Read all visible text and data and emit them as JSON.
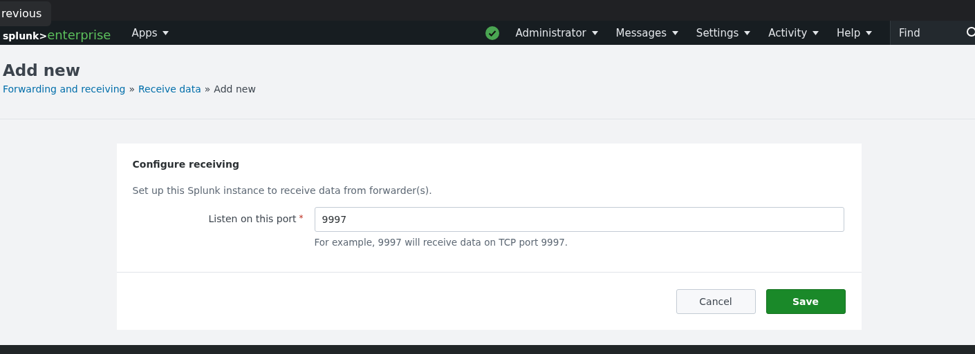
{
  "tooltip": {
    "text": "revious"
  },
  "logo": {
    "brand": "splunk>",
    "product": "enterprise"
  },
  "nav": {
    "apps": "Apps",
    "status_ok": true,
    "menus": [
      {
        "label": "Administrator"
      },
      {
        "label": "Messages"
      },
      {
        "label": "Settings"
      },
      {
        "label": "Activity"
      },
      {
        "label": "Help"
      }
    ],
    "search": {
      "placeholder": "Find"
    }
  },
  "page": {
    "title": "Add new",
    "breadcrumbs": [
      {
        "label": "Forwarding and receiving",
        "link": true
      },
      {
        "label": "Receive data",
        "link": true
      },
      {
        "label": "Add new",
        "link": false
      }
    ],
    "separator": "»"
  },
  "form": {
    "heading": "Configure receiving",
    "description": "Set up this Splunk instance to receive data from forwarder(s).",
    "field": {
      "label": "Listen on this port",
      "required": true,
      "required_mark": "*",
      "value": "9997",
      "help": "For example, 9997 will receive data on TCP port 9997."
    },
    "buttons": [
      {
        "label": "Cancel",
        "kind": "secondary"
      },
      {
        "label": "Save",
        "kind": "primary"
      }
    ]
  }
}
